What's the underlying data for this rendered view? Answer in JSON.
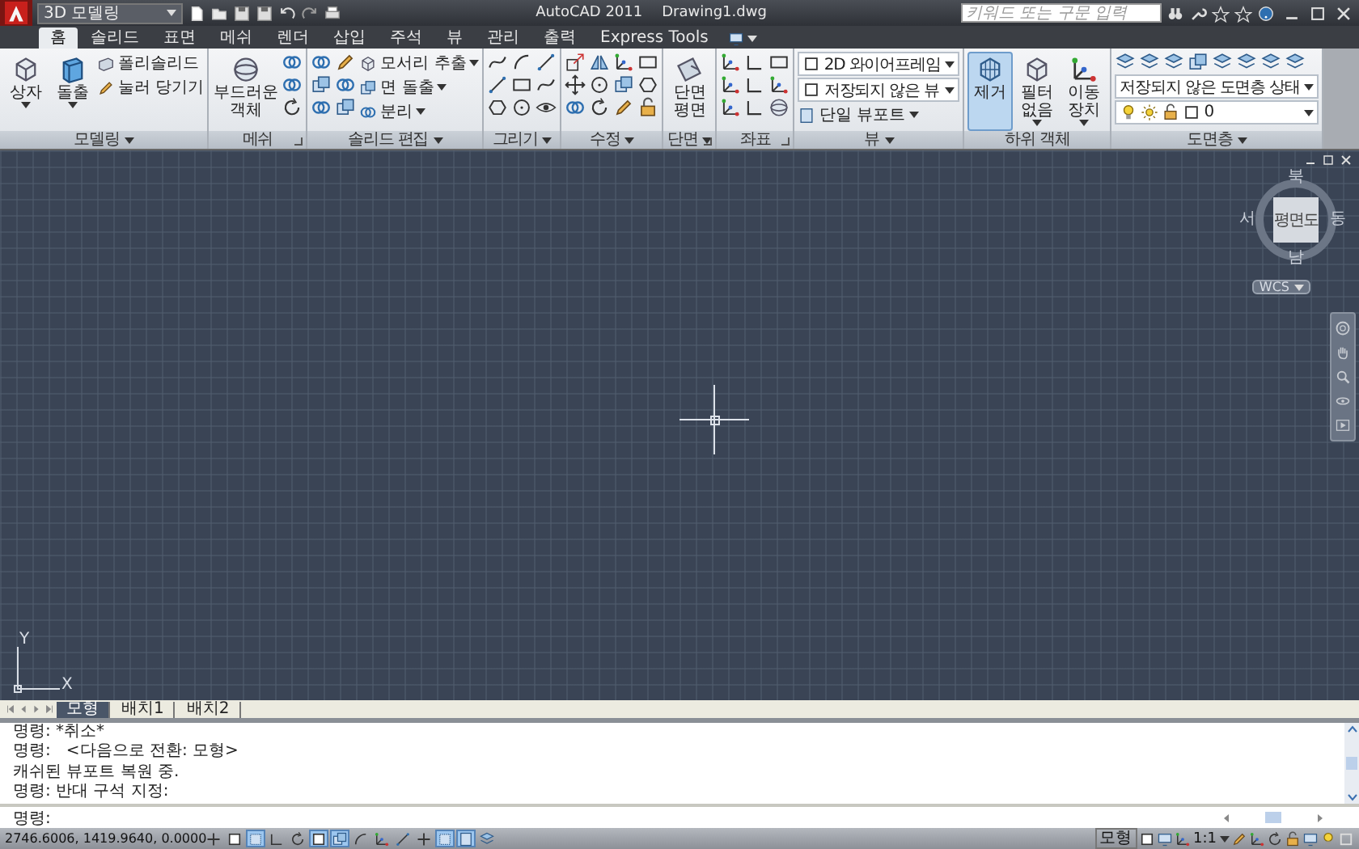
{
  "quick_access": {
    "workspace": "3D 모델링"
  },
  "title": {
    "app": "AutoCAD 2011",
    "file": "Drawing1.dwg"
  },
  "search": {
    "placeholder": "키워드 또는 구문 입력"
  },
  "ribbon_tabs": [
    {
      "label": "홈",
      "selected": true
    },
    {
      "label": "솔리드",
      "selected": false
    },
    {
      "label": "표면",
      "selected": false
    },
    {
      "label": "메쉬",
      "selected": false
    },
    {
      "label": "렌더",
      "selected": false
    },
    {
      "label": "삽입",
      "selected": false
    },
    {
      "label": "주석",
      "selected": false
    },
    {
      "label": "뷰",
      "selected": false
    },
    {
      "label": "관리",
      "selected": false
    },
    {
      "label": "출력",
      "selected": false
    },
    {
      "label": "Express Tools",
      "selected": false
    }
  ],
  "panels": [
    {
      "title": "모델링",
      "kind": "stack",
      "menu": true,
      "launcher": false,
      "items": [
        {
          "kind": "large",
          "label": "상자",
          "dropdown": true
        },
        {
          "kind": "large",
          "label": "돌출",
          "dropdown": true
        },
        {
          "kind": "small",
          "label": "폴리솔리드",
          "dropdown": false
        },
        {
          "kind": "small",
          "label": "눌러 당기기",
          "dropdown": false
        }
      ]
    },
    {
      "title": "메쉬",
      "kind": "stack",
      "menu": false,
      "launcher": true,
      "items": [
        {
          "kind": "large",
          "label": "부드러운 객체",
          "dropdown": false
        }
      ]
    },
    {
      "title": "솔리드 편집",
      "kind": "stack",
      "menu": true,
      "launcher": false,
      "items": [
        {
          "kind": "small",
          "label": "모서리 추출",
          "dropdown": true
        },
        {
          "kind": "small",
          "label": "면 돌출",
          "dropdown": true
        },
        {
          "kind": "small",
          "label": "분리",
          "dropdown": true
        }
      ]
    },
    {
      "title": "그리기",
      "kind": "stack",
      "menu": true,
      "launcher": false
    },
    {
      "title": "수정",
      "kind": "stack",
      "menu": true,
      "launcher": false
    },
    {
      "title": "단면",
      "kind": "stack",
      "menu": true,
      "launcher": true,
      "items": [
        {
          "kind": "large",
          "label": "단면 평면",
          "dropdown": false
        }
      ]
    },
    {
      "title": "좌표",
      "kind": "stack",
      "menu": false,
      "launcher": true
    },
    {
      "title": "뷰",
      "kind": "stack",
      "menu": true,
      "launcher": false,
      "items": [
        {
          "kind": "combo",
          "label": "2D 와이어프레임",
          "dropdown": true
        },
        {
          "kind": "combo",
          "label": "저장되지 않은 뷰",
          "dropdown": true
        },
        {
          "kind": "small",
          "label": "단일 뷰포트",
          "dropdown": true
        }
      ]
    },
    {
      "title": "하위 객체",
      "kind": "stack",
      "menu": false,
      "launcher": false,
      "items": [
        {
          "kind": "large",
          "label": "제거",
          "dropdown": false,
          "selected": true
        },
        {
          "kind": "large",
          "label": "필터 없음",
          "dropdown": true,
          "selected": false
        },
        {
          "kind": "large",
          "label": "이동 장치",
          "dropdown": true,
          "selected": false
        }
      ]
    },
    {
      "title": "도면층",
      "kind": "rows",
      "menu": true,
      "launcher": false,
      "items": [
        {
          "kind": "combo",
          "label": "저장되지 않은 도면층 상태",
          "dropdown": true
        },
        {
          "kind": "layer",
          "label": "0",
          "dropdown": true
        }
      ]
    }
  ],
  "viewport": {
    "viewcube": {
      "north": "북",
      "east": "동",
      "south": "남",
      "west": "서",
      "face": "평면도"
    },
    "ucs_menu": "WCS",
    "ucs_icon": {
      "x": "X",
      "y": "Y"
    }
  },
  "layout_tabs": [
    {
      "label": "모형",
      "selected": true
    },
    {
      "label": "배치1",
      "selected": false
    },
    {
      "label": "배치2",
      "selected": false
    }
  ],
  "command_history": [
    "명령: *취소*",
    "명령:   <다음으로 전환: 모형>",
    "캐쉬된 뷰포트 복원 중.",
    "명령: 반대 구석 지정:"
  ],
  "command_prompt": "명령:",
  "status_bar": {
    "coordinates": "2746.6006, 1419.9640, 0.0000",
    "toggles": [
      {
        "on": false
      },
      {
        "on": false
      },
      {
        "on": true
      },
      {
        "on": false
      },
      {
        "on": false
      },
      {
        "on": true
      },
      {
        "on": true
      },
      {
        "on": false
      },
      {
        "on": false
      },
      {
        "on": false
      },
      {
        "on": false
      },
      {
        "on": true
      },
      {
        "on": true
      },
      {
        "on": false
      }
    ],
    "space": "모형",
    "scale": "1:1"
  }
}
